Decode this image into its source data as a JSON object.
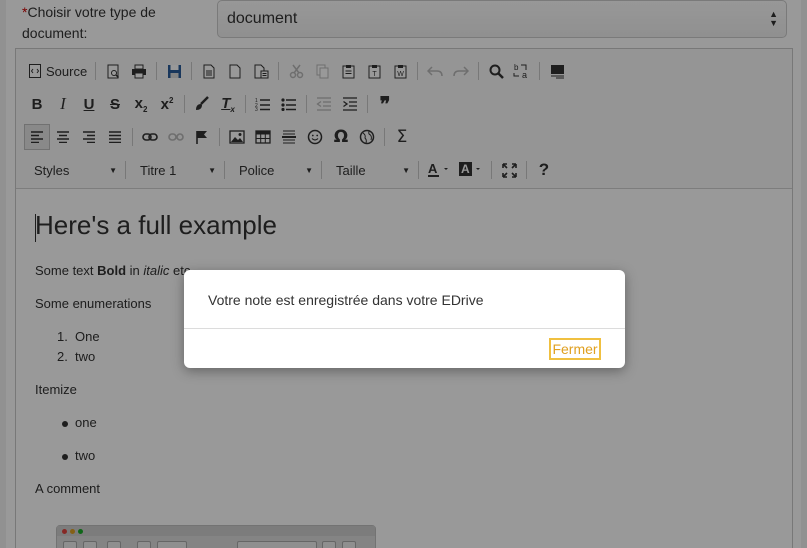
{
  "form": {
    "required_mark": "*",
    "type_label": "Choisir votre type de document:",
    "type_value": "document",
    "type_select_arrows": "▲▼"
  },
  "toolbar": {
    "source_label": "Source",
    "styles_label": "Styles",
    "format_label": "Titre 1",
    "font_label": "Police",
    "size_label": "Taille",
    "help_label": "?"
  },
  "content": {
    "heading": "Here's a full example",
    "p1_prefix": "Some text ",
    "p1_bold": "Bold",
    "p1_mid": " in ",
    "p1_italic": "italic",
    "p1_suffix": " etc.",
    "enum_title": "Some enumerations",
    "ordered": [
      {
        "num": "1.",
        "text": "One"
      },
      {
        "num": "2.",
        "text": "two"
      }
    ],
    "itemize_title": "Itemize",
    "bullets": [
      "one",
      "two"
    ],
    "comment": "A comment"
  },
  "dialog": {
    "message": "Votre note est enregistrée dans votre EDrive",
    "close_label": "Fermer"
  },
  "colors": {
    "accent": "#f0c040",
    "required": "#cc0000",
    "overlay": "rgba(0,0,0,0.40)"
  }
}
